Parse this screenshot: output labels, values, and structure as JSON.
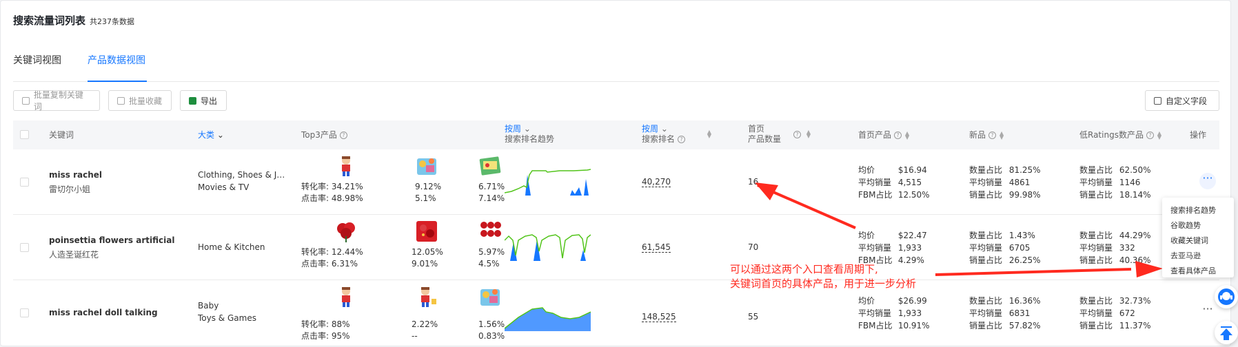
{
  "header": {
    "title": "搜索流量词列表",
    "count": "共237条数据"
  },
  "tabs": [
    {
      "label": "关键词视图"
    },
    {
      "label": "产品数据视图"
    }
  ],
  "toolbar": {
    "batch_copy": "批量复制关键词",
    "batch_fav": "批量收藏",
    "export": "导出",
    "custom_fields": "自定义字段"
  },
  "columns": {
    "keyword": "关键词",
    "category": "大类",
    "top3": "Top3产品",
    "trend_period": "按周",
    "trend_label": "搜索排名趋势",
    "rank_period": "按周",
    "rank_label": "搜索排名",
    "count_line1": "首页",
    "count_line2": "产品数量",
    "first_page": "首页产品",
    "new": "新品",
    "low_ratings": "低Ratings数产品",
    "action": "操作"
  },
  "labels": {
    "cvr": "转化率:",
    "ctr": "点击率:",
    "avg_price": "均价",
    "avg_sales": "平均销量",
    "fbm_share": "FBM占比",
    "qty_share": "数量占比",
    "sales_share": "销量占比"
  },
  "rows": [
    {
      "keyword": "miss rachel",
      "keyword_cn": "雷切尔小姐",
      "categories": [
        "Clothing, Shoes & Je...",
        "Movies & TV"
      ],
      "products": [
        {
          "icon": "doll-image",
          "cvr": "34.21%",
          "ctr": "48.98%"
        },
        {
          "icon": "toy-set-image",
          "cvr": "9.12%",
          "ctr": "5.1%"
        },
        {
          "icon": "book-image",
          "cvr": "6.71%",
          "ctr": "7.14%"
        }
      ],
      "rank": "40,270",
      "page_count": "16",
      "first_page": {
        "avg_price": "$16.94",
        "avg_sales": "4,515",
        "fbm": "12.50%"
      },
      "new": {
        "qty": "81.25%",
        "avg_sales": "4861",
        "sales": "99.98%"
      },
      "low": {
        "qty": "62.50%",
        "avg_sales": "1146",
        "sales": "18.14%"
      }
    },
    {
      "keyword": "poinsettia flowers artificial",
      "keyword_cn": "人造圣诞红花",
      "categories": [
        "Home & Kitchen"
      ],
      "products": [
        {
          "icon": "poinsettia-image",
          "cvr": "12.44%",
          "ctr": "6.31%"
        },
        {
          "icon": "poinsettia-image",
          "cvr": "12.05%",
          "ctr": "9.01%"
        },
        {
          "icon": "poinsettia-image",
          "cvr": "5.97%",
          "ctr": "4.5%"
        }
      ],
      "rank": "61,545",
      "page_count": "70",
      "first_page": {
        "avg_price": "$22.47",
        "avg_sales": "1,933",
        "fbm": "4.29%"
      },
      "new": {
        "qty": "1.43%",
        "avg_sales": "6705",
        "sales": "26.25%"
      },
      "low": {
        "qty": "44.29%",
        "avg_sales": "332",
        "sales": "40.36%"
      }
    },
    {
      "keyword": "miss rachel doll talking",
      "keyword_cn": "",
      "categories": [
        "Baby",
        "Toys & Games"
      ],
      "products": [
        {
          "icon": "doll-image",
          "cvr": "88%",
          "ctr": "95%"
        },
        {
          "icon": "doll-image",
          "cvr": "2.22%",
          "ctr": "--"
        },
        {
          "icon": "toy-set-image",
          "cvr": "1.56%",
          "ctr": "0.83%"
        }
      ],
      "rank": "148,525",
      "page_count": "55",
      "first_page": {
        "avg_price": "$26.99",
        "avg_sales": "1,933",
        "fbm": "10.91%"
      },
      "new": {
        "qty": "16.36%",
        "avg_sales": "6831",
        "sales": "57.82%"
      },
      "low": {
        "qty": "32.73%",
        "avg_sales": "672",
        "sales": "11.37%"
      }
    }
  ],
  "menu": [
    "搜索排名趋势",
    "谷歌趋势",
    "收藏关键词",
    "去亚马逊",
    "查看具体产品"
  ],
  "annotation": [
    "可以通过这两个入口查看周期下,",
    "关键词首页的具体产品，用于进一步分析"
  ],
  "colors": {
    "accent": "#1677ff",
    "annotation": "#ff2a1f",
    "spark_line": "#52c41a",
    "spark_fill": "#1677ff"
  }
}
